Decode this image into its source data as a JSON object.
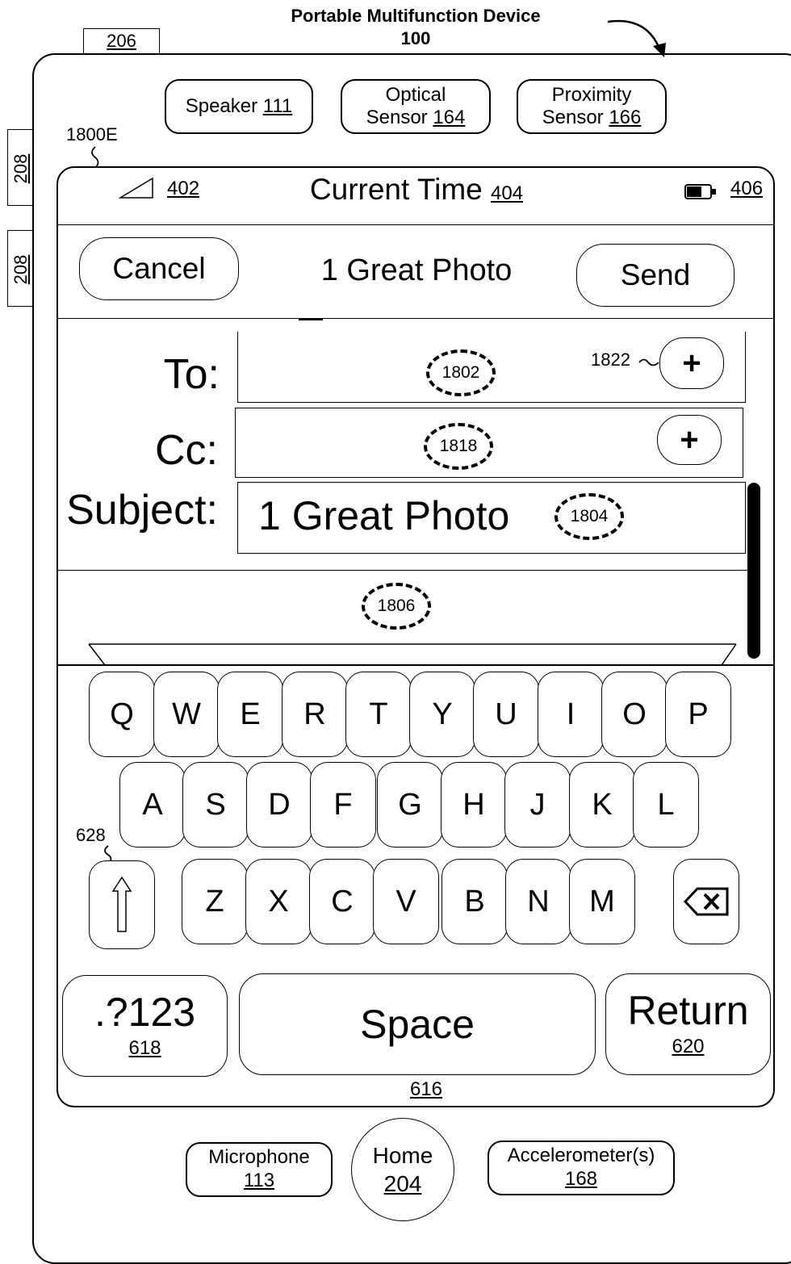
{
  "header": {
    "title": "Portable Multifunction Device",
    "number": "100"
  },
  "refs": {
    "r206": "206",
    "r208a": "208",
    "r208b": "208",
    "screen_ref": "1800E",
    "r1822": "1822",
    "r628": "628",
    "r616": "616"
  },
  "top_components": [
    {
      "name": "Speaker",
      "number": "111"
    },
    {
      "name_line1": "Optical",
      "name_line2": "Sensor",
      "number": "164"
    },
    {
      "name_line1": "Proximity",
      "name_line2": "Sensor",
      "number": "166"
    }
  ],
  "status_bar": {
    "signal_ref": "402",
    "time_label": "Current Time",
    "time_ref": "404",
    "battery_ref": "406"
  },
  "nav_bar": {
    "cancel": "Cancel",
    "title": "1 Great Photo",
    "send": "Send"
  },
  "form": {
    "to_label": "To:",
    "to_ref": "1802",
    "cc_label": "Cc:",
    "cc_ref": "1818",
    "subject_label": "Subject:",
    "subject_value": "1 Great Photo",
    "subject_ref": "1804",
    "body_ref": "1806",
    "plus": "+"
  },
  "keyboard": {
    "row1": [
      "Q",
      "W",
      "E",
      "R",
      "T",
      "Y",
      "U",
      "I",
      "O",
      "P"
    ],
    "row2": [
      "A",
      "S",
      "D",
      "F",
      "G",
      "H",
      "J",
      "K",
      "L"
    ],
    "row3": [
      "Z",
      "X",
      "C",
      "V",
      "B",
      "N",
      "M"
    ],
    "numbers_label": ".?123",
    "numbers_ref": "618",
    "space_label": "Space",
    "return_label": "Return",
    "return_ref": "620"
  },
  "bottom_components": [
    {
      "name": "Microphone",
      "number": "113"
    },
    {
      "name": "Home",
      "number": "204"
    },
    {
      "name": "Accelerometer(s)",
      "number": "168"
    }
  ]
}
